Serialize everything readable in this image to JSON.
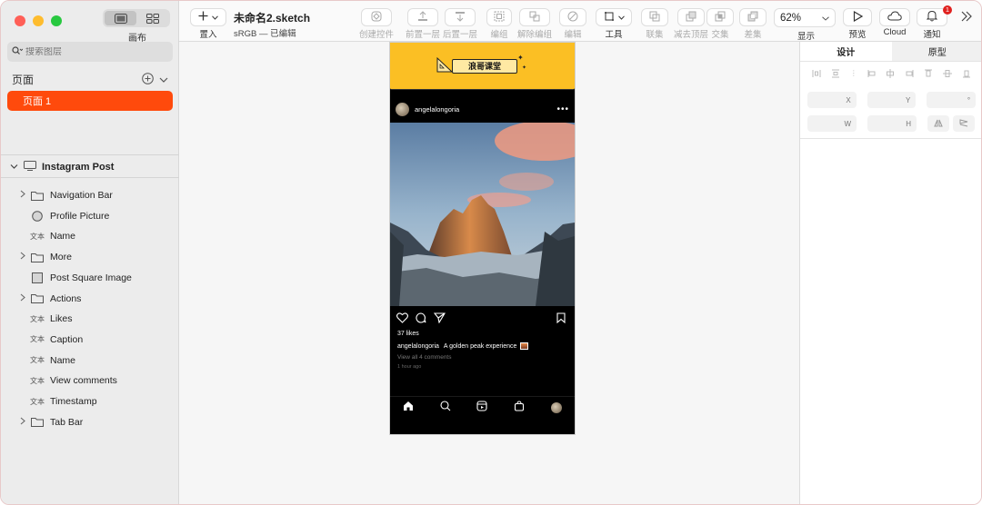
{
  "sidebar": {
    "canvas_label": "画布",
    "search_placeholder": "搜索图层",
    "pages_title": "页面",
    "current_page": "页面 1",
    "artboard": "Instagram Post",
    "layers": [
      {
        "label": "Navigation Bar",
        "type": "group",
        "expandable": true
      },
      {
        "label": "Profile Picture",
        "type": "oval",
        "expandable": false
      },
      {
        "label": "Name",
        "type": "text",
        "expandable": false
      },
      {
        "label": "More",
        "type": "group",
        "expandable": true
      },
      {
        "label": "Post Square Image",
        "type": "image",
        "expandable": false
      },
      {
        "label": "Actions",
        "type": "group",
        "expandable": true
      },
      {
        "label": "Likes",
        "type": "text",
        "expandable": false
      },
      {
        "label": "Caption",
        "type": "text",
        "expandable": false
      },
      {
        "label": "Name",
        "type": "text",
        "expandable": false
      },
      {
        "label": "View comments",
        "type": "text",
        "expandable": false
      },
      {
        "label": "Timestamp",
        "type": "text",
        "expandable": false
      },
      {
        "label": "Tab Bar",
        "type": "group",
        "expandable": true
      }
    ],
    "text_icon_label": "文本"
  },
  "toolbar": {
    "insert": "置入",
    "doc_name": "未命名2.sketch",
    "doc_sub": "sRGB — 已编辑",
    "create_component": "创建控件",
    "forward": "前置一层",
    "backward": "后置一层",
    "group": "编组",
    "ungroup": "解除编组",
    "edit": "编辑",
    "tools": "工具",
    "union": "联集",
    "subtract": "减去顶层",
    "intersect": "交集",
    "difference": "差集",
    "zoom": "62%",
    "display": "显示",
    "preview": "预览",
    "cloud": "Cloud",
    "notify": "通知",
    "notify_count": "1"
  },
  "post": {
    "logo_text": "浪哥课堂",
    "username": "angelalongoria",
    "likes": "37 likes",
    "caption_user": "angelalongoria",
    "caption_text": "A golden peak experience",
    "view_comments": "View all 4 comments",
    "timestamp": "1 hour ago"
  },
  "inspector": {
    "tab_design": "设计",
    "tab_prototype": "原型",
    "x_label": "X",
    "y_label": "Y",
    "rot_label": "°",
    "w_label": "W",
    "h_label": "H"
  }
}
